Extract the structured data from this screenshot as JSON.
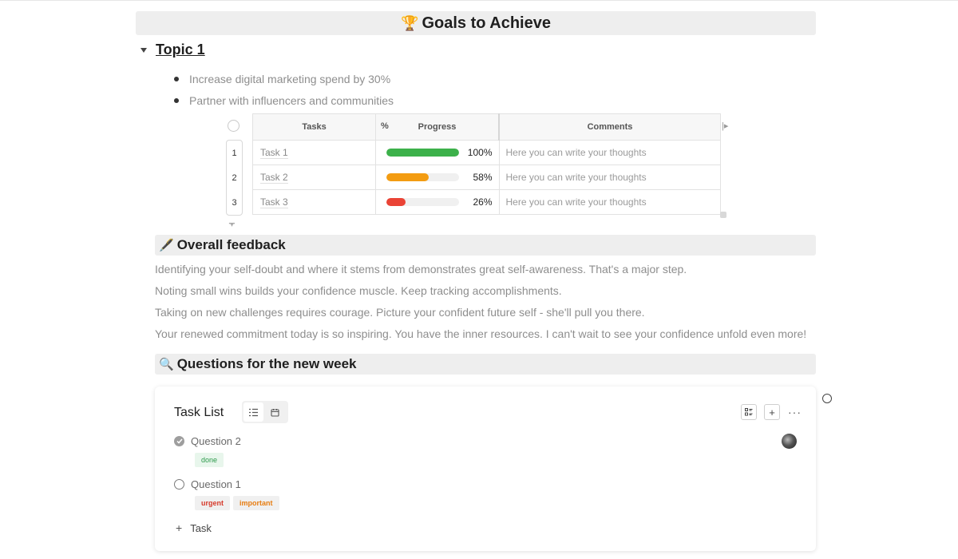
{
  "banner": {
    "icon": "trophy-icon",
    "emoji": "🏆",
    "title": "Goals to Achieve"
  },
  "topic": {
    "title": "Topic 1"
  },
  "bullets": [
    "Increase digital marketing spend by 30%",
    "Partner with influencers and communities"
  ],
  "table": {
    "headers": {
      "tasks": "Tasks",
      "progress_symbol": "%",
      "progress": "Progress",
      "comments": "Comments"
    },
    "rows": [
      {
        "num": "1",
        "task": "Task 1",
        "progress": 100,
        "progress_label": "100%",
        "color": "#3cb14a",
        "comment": "Here you can write your thoughts"
      },
      {
        "num": "2",
        "task": "Task 2",
        "progress": 58,
        "progress_label": "58%",
        "color": "#f39c12",
        "comment": "Here you can write your thoughts"
      },
      {
        "num": "3",
        "task": "Task 3",
        "progress": 26,
        "progress_label": "26%",
        "color": "#ea4335",
        "comment": "Here you can write your thoughts"
      }
    ]
  },
  "feedback": {
    "icon": "pen-icon",
    "emoji": "🖋️",
    "title": "Overall feedback",
    "lines": [
      "Identifying your self-doubt and where it stems from demonstrates great self-awareness. That's a major step.",
      "Noting small wins builds your confidence muscle. Keep tracking accomplishments.",
      "Taking on new challenges requires courage. Picture your confident future self - she'll pull you there.",
      "Your renewed commitment today is so inspiring. You have the inner resources. I can't wait to see your confidence unfold even more!"
    ]
  },
  "questions": {
    "icon": "magnifier-icon",
    "emoji": "🔍",
    "title": "Questions for the new week"
  },
  "tasklist": {
    "title": "Task List",
    "more": "···",
    "items": [
      {
        "label": "Question 2",
        "done": true,
        "tags": [
          {
            "label": "done",
            "kind": "done"
          }
        ]
      },
      {
        "label": "Question 1",
        "done": false,
        "tags": [
          {
            "label": "urgent",
            "kind": "urgent"
          },
          {
            "label": "important",
            "kind": "important"
          }
        ]
      }
    ],
    "add_label": "Task",
    "add_symbol": "+"
  }
}
